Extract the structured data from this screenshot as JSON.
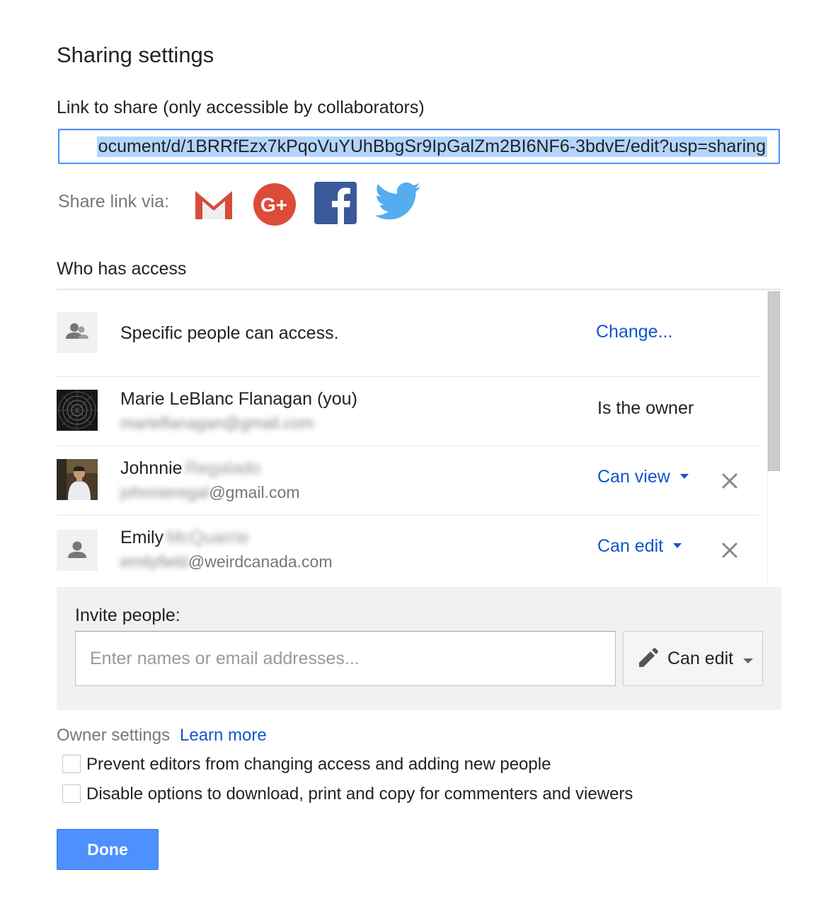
{
  "dialog": {
    "title": "Sharing settings"
  },
  "link": {
    "label": "Link to share (only accessible by collaborators)",
    "url": "ocument/d/1BRRfEzx7kPqoVuYUhBbgSr9IpGalZm2BI6NF6-3bdvE/edit?usp=sharing"
  },
  "share_via": {
    "label": "Share link via:",
    "services": [
      "gmail-icon",
      "google-plus-icon",
      "facebook-icon",
      "twitter-icon"
    ]
  },
  "access": {
    "heading": "Who has access",
    "visibility": {
      "text": "Specific people can access.",
      "change_label": "Change..."
    },
    "people": [
      {
        "name": "Marie LeBlanc Flanagan (you)",
        "name_hidden": "",
        "email_hidden": "marieflanagan@gmail.com",
        "email_visible": "",
        "role": "Is the owner"
      },
      {
        "name": "Johnnie",
        "name_hidden": "Regalado",
        "email_hidden": "johnnieregal",
        "email_visible": "@gmail.com",
        "role": "Can view"
      },
      {
        "name": "Emily",
        "name_hidden": "McQuarrie",
        "email_hidden": "emilyfield",
        "email_visible": "@weirdcanada.com",
        "role": "Can edit"
      }
    ]
  },
  "invite": {
    "label": "Invite people:",
    "placeholder": "Enter names or email addresses...",
    "permission": "Can edit"
  },
  "owner_settings": {
    "label": "Owner settings",
    "learn_more": "Learn more",
    "options": [
      "Prevent editors from changing access and adding new people",
      "Disable options to download, print and copy for commenters and viewers"
    ]
  },
  "done_label": "Done",
  "colors": {
    "link_blue": "#1155cc",
    "button_blue": "#4d90fe",
    "selection": "#b4d5fe"
  }
}
